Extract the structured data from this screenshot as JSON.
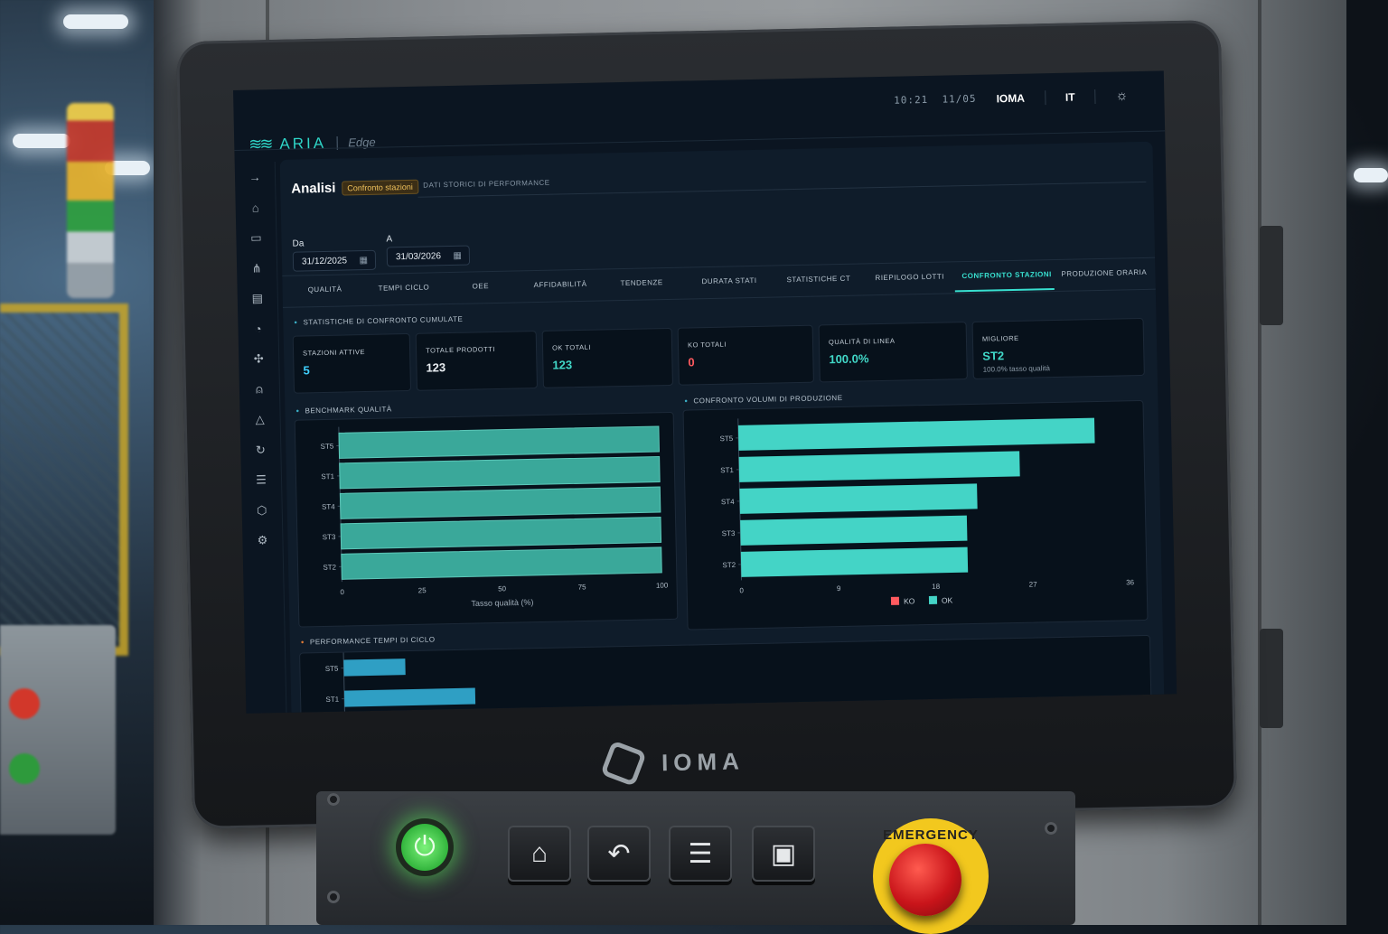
{
  "brand": {
    "name": "ARIA",
    "edition": "Edge"
  },
  "topbar": {
    "time": "10:21",
    "date": "11/05",
    "org": "IOMA",
    "language": "IT",
    "theme_icon": "sun-icon"
  },
  "sidebar": {
    "items": [
      {
        "icon": "arrow-right-icon",
        "glyph": "→"
      },
      {
        "icon": "home-icon",
        "glyph": "⌂"
      },
      {
        "icon": "monitor-icon",
        "glyph": "▭"
      },
      {
        "icon": "share-icon",
        "glyph": "⋔"
      },
      {
        "icon": "document-icon",
        "glyph": "▤"
      },
      {
        "icon": "gauge-icon",
        "glyph": "◔"
      },
      {
        "icon": "network-icon",
        "glyph": "✣"
      },
      {
        "icon": "user-icon",
        "glyph": "⍝"
      },
      {
        "icon": "bell-icon",
        "glyph": "△"
      },
      {
        "icon": "sync-icon",
        "glyph": "↻"
      },
      {
        "icon": "list-icon",
        "glyph": "☰"
      },
      {
        "icon": "cube-icon",
        "glyph": "⬡"
      },
      {
        "icon": "settings-icon",
        "glyph": "⚙"
      }
    ]
  },
  "page": {
    "title": "Analisi",
    "badge": "Confronto stazioni",
    "subtitle": "DATI STORICI DI PERFORMANCE"
  },
  "filters": {
    "from_label": "Da",
    "from_value": "31/12/2025",
    "to_label": "A",
    "to_value": "31/03/2026",
    "calendar_icon": "calendar-icon"
  },
  "tabs": [
    {
      "label": "QUALITÀ",
      "active": false
    },
    {
      "label": "TEMPI CICLO",
      "active": false
    },
    {
      "label": "OEE",
      "active": false
    },
    {
      "label": "AFFIDABILITÀ",
      "active": false
    },
    {
      "label": "TENDENZE",
      "active": false
    },
    {
      "label": "DURATA STATI",
      "active": false
    },
    {
      "label": "STATISTICHE CT",
      "active": false
    },
    {
      "label": "RIEPILOGO LOTTI",
      "active": false
    },
    {
      "label": "CONFRONTO STAZIONI",
      "active": true
    },
    {
      "label": "PRODUZIONE ORARIA",
      "active": false
    }
  ],
  "summary": {
    "title": "STATISTICHE DI CONFRONTO CUMULATE",
    "cards": [
      {
        "label": "STAZIONI ATTIVE",
        "value": "5",
        "color": "#3fd0ff",
        "sub": ""
      },
      {
        "label": "TOTALE PRODOTTI",
        "value": "123",
        "color": "#e9eef2",
        "sub": ""
      },
      {
        "label": "OK TOTALI",
        "value": "123",
        "color": "#41d8c8",
        "sub": ""
      },
      {
        "label": "KO TOTALI",
        "value": "0",
        "color": "#ff5a5f",
        "sub": ""
      },
      {
        "label": "QUALITÀ DI LINEA",
        "value": "100.0%",
        "color": "#41d8c8",
        "sub": ""
      },
      {
        "label": "MIGLIORE",
        "value": "ST2",
        "color": "#41d8c8",
        "sub": "100.0% tasso qualità"
      }
    ]
  },
  "chart_data": [
    {
      "type": "bar",
      "orientation": "horizontal",
      "title": "BENCHMARK QUALITÀ",
      "categories": [
        "ST5",
        "ST1",
        "ST4",
        "ST3",
        "ST2"
      ],
      "values": [
        100,
        100,
        100,
        100,
        100
      ],
      "xlabel": "Tasso qualità (%)",
      "xlim": [
        0,
        100
      ],
      "xticks": [
        0,
        25,
        50,
        75,
        100
      ],
      "color": "#3aa89a",
      "grid": false
    },
    {
      "type": "bar",
      "orientation": "horizontal",
      "stacked": true,
      "title": "CONFRONTO VOLUMI DI PRODUZIONE",
      "categories": [
        "ST5",
        "ST1",
        "ST4",
        "ST3",
        "ST2"
      ],
      "series": [
        {
          "name": "KO",
          "values": [
            0,
            0,
            0,
            0,
            0
          ],
          "color": "#ff5a5f"
        },
        {
          "name": "OK",
          "values": [
            33,
            26,
            22,
            21,
            21
          ],
          "color": "#44d4c6"
        }
      ],
      "xlim": [
        0,
        36
      ],
      "xticks": [
        0,
        9,
        18,
        27,
        36
      ],
      "legend": "bottom",
      "grid": false
    },
    {
      "type": "bar",
      "orientation": "horizontal",
      "title": "PERFORMANCE TEMPI DI CICLO",
      "categories": [
        "ST5",
        "ST1"
      ],
      "values": [
        8,
        17
      ],
      "xlim": [
        0,
        100
      ],
      "color": "#2f9fc4",
      "partial": true
    }
  ],
  "device": {
    "bezel_brand": "IOMA",
    "buttons": [
      "power-icon",
      "home-icon",
      "back-icon",
      "menu-icon",
      "screen-icon"
    ],
    "emergency_label": "EMERGENCY"
  }
}
